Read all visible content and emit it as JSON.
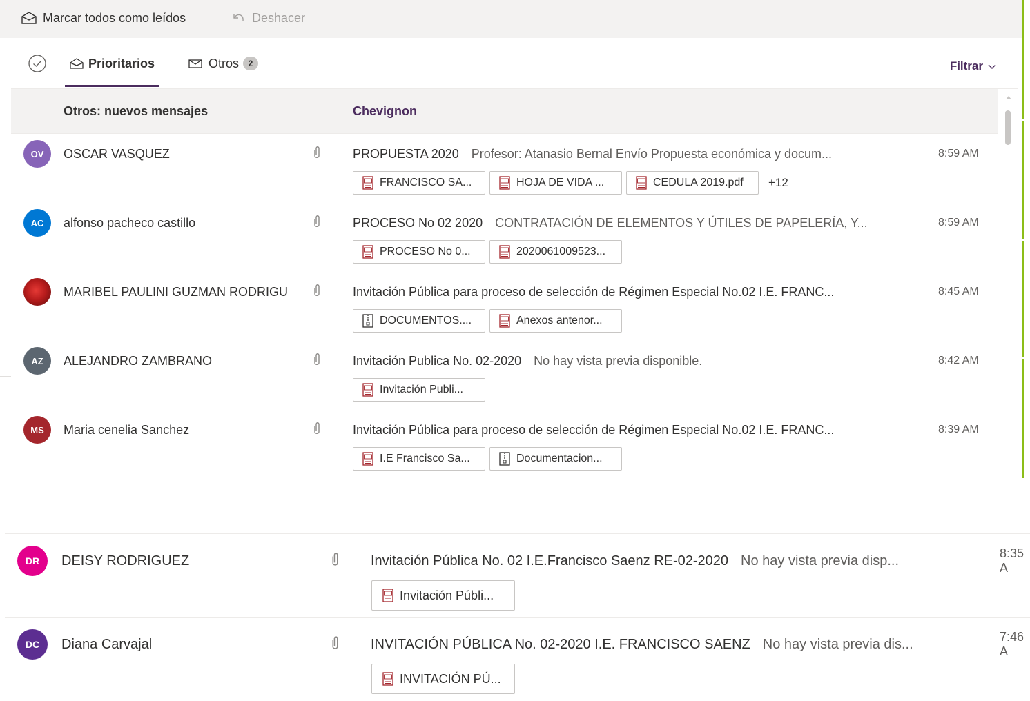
{
  "toolbar": {
    "mark_all_read": "Marcar todos como leídos",
    "undo": "Deshacer"
  },
  "tabs": {
    "focused": "Prioritarios",
    "other": "Otros",
    "other_count": "2",
    "filter": "Filtrar"
  },
  "others_banner": {
    "label": "Otros: nuevos mensajes",
    "sender": "Chevignon"
  },
  "colors": {
    "accent": "#4b2c5e",
    "green_bar": "#8cbd18"
  },
  "messages": [
    {
      "initials": "OV",
      "avatar_color": "#8764b8",
      "sender": "OSCAR VASQUEZ",
      "subject": "PROPUESTA 2020",
      "preview": "Profesor: Atanasio Bernal Envío Propuesta económica y docum...",
      "time": "8:59 AM",
      "attachments": [
        {
          "icon": "pdf-icon",
          "name": "FRANCISCO SA..."
        },
        {
          "icon": "pdf-icon",
          "name": "HOJA DE VIDA ..."
        },
        {
          "icon": "pdf-icon",
          "name": "CEDULA 2019.pdf"
        }
      ],
      "more": "+12"
    },
    {
      "initials": "AC",
      "avatar_color": "#0078d4",
      "sender": "alfonso pacheco castillo",
      "subject": "PROCESO No 02 2020",
      "preview": "CONTRATACIÓN DE ELEMENTOS Y ÚTILES DE PAPELERÍA, Y...",
      "time": "8:59 AM",
      "attachments": [
        {
          "icon": "pdf-icon",
          "name": "PROCESO No 0..."
        },
        {
          "icon": "pdf-icon",
          "name": "2020061009523..."
        }
      ]
    },
    {
      "initials": "",
      "avatar_color": "#b01c18",
      "avatar_photo": "photo-avatar",
      "sender": "MARIBEL PAULINI GUZMAN RODRIGU",
      "subject": "Invitación Pública para proceso de selección de Régimen Especial No.02 I.E. FRANC...",
      "preview": "",
      "time": "8:45 AM",
      "attachments": [
        {
          "icon": "zip-icon",
          "name": "DOCUMENTOS...."
        },
        {
          "icon": "pdf-icon",
          "name": "Anexos antenor..."
        }
      ]
    },
    {
      "initials": "AZ",
      "avatar_color": "#5c6670",
      "sender": "ALEJANDRO ZAMBRANO",
      "subject": "Invitación Publica No. 02-2020",
      "preview": "No hay vista previa disponible.",
      "time": "8:42 AM",
      "attachments": [
        {
          "icon": "pdf-icon",
          "name": "Invitación Publi..."
        }
      ]
    },
    {
      "initials": "MS",
      "avatar_color": "#a4262c",
      "sender": "Maria cenelia Sanchez",
      "subject": "Invitación Pública para proceso de selección de Régimen Especial No.02 I.E. FRANC...",
      "preview": "",
      "time": "8:39 AM",
      "attachments": [
        {
          "icon": "pdf-icon",
          "name": "I.E Francisco Sa..."
        },
        {
          "icon": "zip-icon",
          "name": "Documentacion..."
        }
      ]
    }
  ],
  "messages_lower": [
    {
      "initials": "DR",
      "avatar_color": "#e3008c",
      "sender": "DEISY RODRIGUEZ",
      "subject": "Invitación Pública No. 02 I.E.Francisco Saenz RE-02-2020",
      "preview": "No hay vista previa disp...",
      "time": "8:35 A",
      "attachments": [
        {
          "icon": "pdf-icon",
          "name": "Invitación Públi..."
        }
      ]
    },
    {
      "initials": "DC",
      "avatar_color": "#5c2e91",
      "sender": "Diana Carvajal",
      "subject": "INVITACIÓN PÚBLICA No. 02-2020 I.E. FRANCISCO SAENZ",
      "preview": "No hay vista previa dis...",
      "time": "7:46 A",
      "attachments": [
        {
          "icon": "pdf-icon",
          "name": "INVITACIÓN PÚ..."
        }
      ]
    }
  ]
}
